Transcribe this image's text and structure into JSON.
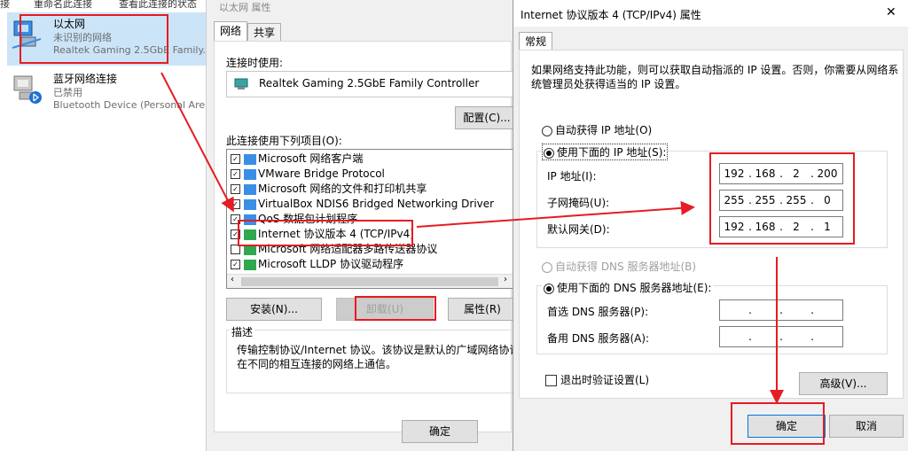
{
  "left_panel": {
    "top_links": [
      "接",
      "重命名此连接",
      "查看此连接的状态"
    ],
    "adapters": [
      {
        "title": "以太网",
        "status": "未识别的网络",
        "device": "Realtek Gaming 2.5GbE Family..."
      },
      {
        "title": "蓝牙网络连接",
        "status": "已禁用",
        "device": "Bluetooth Device (Personal Are..."
      }
    ]
  },
  "props_window": {
    "title": "以太网 属性",
    "tabs": [
      "网络",
      "共享"
    ],
    "connect_using_label": "连接时使用:",
    "adapter_name": "Realtek Gaming 2.5GbE Family Controller",
    "configure_button": "配置(C)...",
    "items_label": "此连接使用下列项目(O):",
    "items": [
      {
        "label": "Microsoft 网络客户端",
        "checked": true
      },
      {
        "label": "VMware Bridge Protocol",
        "checked": true
      },
      {
        "label": "Microsoft 网络的文件和打印机共享",
        "checked": true
      },
      {
        "label": "VirtualBox NDIS6 Bridged Networking Driver",
        "checked": true
      },
      {
        "label": "QoS 数据包计划程序",
        "checked": true
      },
      {
        "label": "Internet 协议版本 4 (TCP/IPv4)",
        "checked": true
      },
      {
        "label": "Microsoft 网络适配器多路传送器协议",
        "checked": false
      },
      {
        "label": "Microsoft LLDP 协议驱动程序",
        "checked": true
      }
    ],
    "install_button": "安装(N)...",
    "uninstall_button": "卸载(U)",
    "properties_button": "属性(R)",
    "description_label": "描述",
    "description_line1": "传输控制协议/Internet 协议。该协议是默认的广域网络协议，用",
    "description_line2": "在不同的相互连接的网络上通信。",
    "ok_button": "确定"
  },
  "ipv4_dialog": {
    "title": "Internet 协议版本 4 (TCP/IPv4) 属性",
    "close_glyph": "✕",
    "tab": "常规",
    "intro_line1": "如果网络支持此功能，则可以获取自动指派的 IP 设置。否则，你需要从网络系",
    "intro_line2": "统管理员处获得适当的 IP 设置。",
    "auto_ip_label": "自动获得 IP 地址(O)",
    "manual_ip_label": "使用下面的 IP 地址(S):",
    "ip_label": "IP 地址(I):",
    "mask_label": "子网掩码(U):",
    "gateway_label": "默认网关(D):",
    "ip": [
      "192",
      "168",
      "2",
      "200"
    ],
    "mask": [
      "255",
      "255",
      "255",
      "0"
    ],
    "gateway": [
      "192",
      "168",
      "2",
      "1"
    ],
    "dot": ".",
    "auto_dns_label": "自动获得 DNS 服务器地址(B)",
    "manual_dns_label": "使用下面的 DNS 服务器地址(E):",
    "pref_dns_label": "首选 DNS 服务器(P):",
    "alt_dns_label": "备用 DNS 服务器(A):",
    "validate_label": "退出时验证设置(L)",
    "advanced_button": "高级(V)...",
    "ok_button": "确定",
    "cancel_button": "取消"
  },
  "colors": {
    "highlight": "#e51c23",
    "selection": "#cce4f7",
    "accent": "#0078d7"
  }
}
